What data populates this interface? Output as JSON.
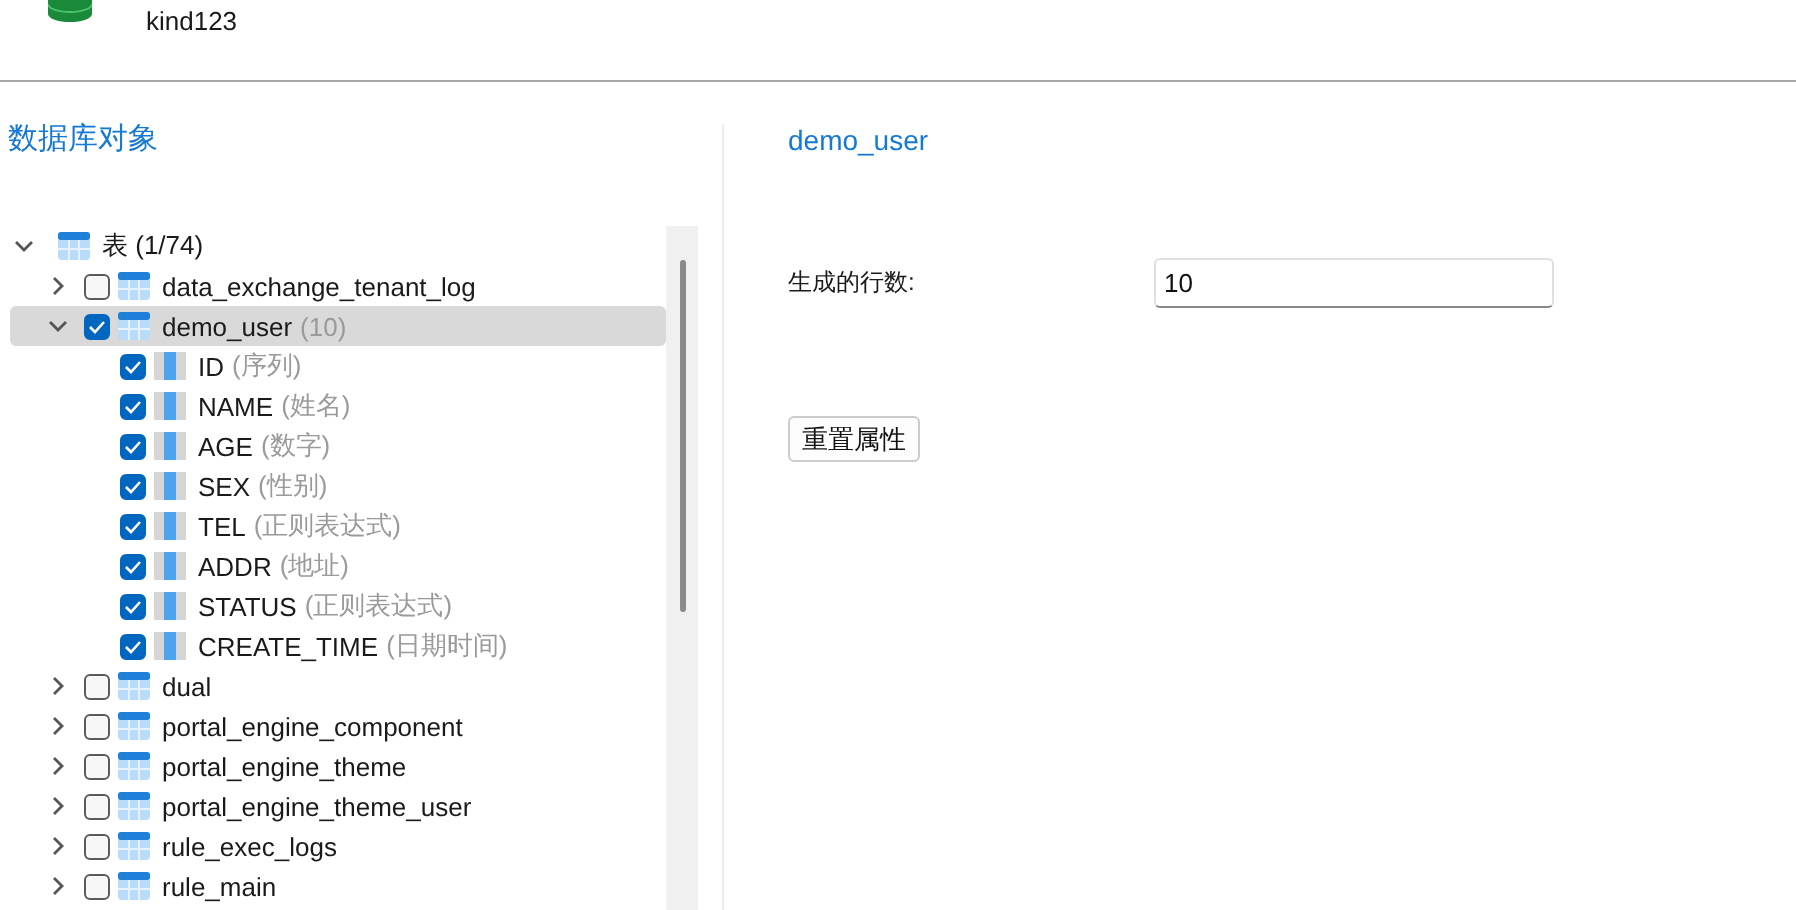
{
  "header": {
    "connection": "kind123"
  },
  "sidebar": {
    "title": "数据库对象",
    "tree": [
      {
        "kind": "group",
        "label": "表 (1/74)",
        "expanded": true,
        "selected": false,
        "children": [
          {
            "kind": "table",
            "label": "data_exchange_tenant_log",
            "expanded": false,
            "checked": false,
            "selected": false
          },
          {
            "kind": "table",
            "label": "demo_user",
            "detail": "(10)",
            "expanded": true,
            "checked": true,
            "selected": true,
            "children": [
              {
                "kind": "column",
                "label": "ID",
                "detail": "(序列)",
                "checked": true,
                "selected": false
              },
              {
                "kind": "column",
                "label": "NAME",
                "detail": "(姓名)",
                "checked": true,
                "selected": false
              },
              {
                "kind": "column",
                "label": "AGE",
                "detail": "(数字)",
                "checked": true,
                "selected": false
              },
              {
                "kind": "column",
                "label": "SEX",
                "detail": "(性别)",
                "checked": true,
                "selected": false
              },
              {
                "kind": "column",
                "label": "TEL",
                "detail": "(正则表达式)",
                "checked": true,
                "selected": false
              },
              {
                "kind": "column",
                "label": "ADDR",
                "detail": "(地址)",
                "checked": true,
                "selected": false
              },
              {
                "kind": "column",
                "label": "STATUS",
                "detail": "(正则表达式)",
                "checked": true,
                "selected": false
              },
              {
                "kind": "column",
                "label": "CREATE_TIME",
                "detail": "(日期时间)",
                "checked": true,
                "selected": false
              }
            ]
          },
          {
            "kind": "table",
            "label": "dual",
            "expanded": false,
            "checked": false,
            "selected": false
          },
          {
            "kind": "table",
            "label": "portal_engine_component",
            "expanded": false,
            "checked": false,
            "selected": false
          },
          {
            "kind": "table",
            "label": "portal_engine_theme",
            "expanded": false,
            "checked": false,
            "selected": false
          },
          {
            "kind": "table",
            "label": "portal_engine_theme_user",
            "expanded": false,
            "checked": false,
            "selected": false
          },
          {
            "kind": "table",
            "label": "rule_exec_logs",
            "expanded": false,
            "checked": false,
            "selected": false
          },
          {
            "kind": "table",
            "label": "rule_main",
            "expanded": false,
            "checked": false,
            "selected": false
          }
        ]
      }
    ]
  },
  "detail": {
    "title": "demo_user",
    "row_count_label": "生成的行数:",
    "row_count_value": "10",
    "reset_button": "重置属性"
  }
}
